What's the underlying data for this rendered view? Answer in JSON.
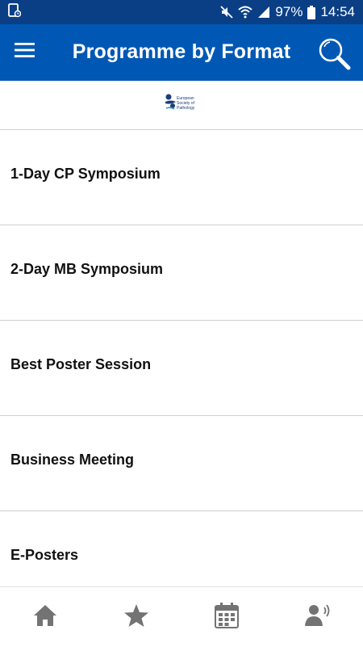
{
  "status_bar": {
    "battery": "97%",
    "time": "14:54",
    "icons": [
      "sim-card-icon",
      "mute-icon",
      "wifi-icon",
      "signal-icon",
      "battery-icon"
    ]
  },
  "header": {
    "title": "Programme by Format",
    "menu_icon": "hamburger-menu-icon",
    "search_icon": "search-icon",
    "background": "#0058b4"
  },
  "logo": {
    "lines": [
      "European",
      "Society of",
      "Pathology"
    ],
    "color": "#1a3d7a"
  },
  "list": {
    "items": [
      {
        "label": "1-Day CP Symposium"
      },
      {
        "label": "2-Day MB Symposium"
      },
      {
        "label": "Best Poster Session"
      },
      {
        "label": "Business Meeting"
      },
      {
        "label": "E-Posters"
      }
    ]
  },
  "bottom_nav": {
    "items": [
      "home-icon",
      "favorites-star-icon",
      "calendar-icon",
      "speaker-profile-icon"
    ],
    "icon_color": "#737373"
  }
}
